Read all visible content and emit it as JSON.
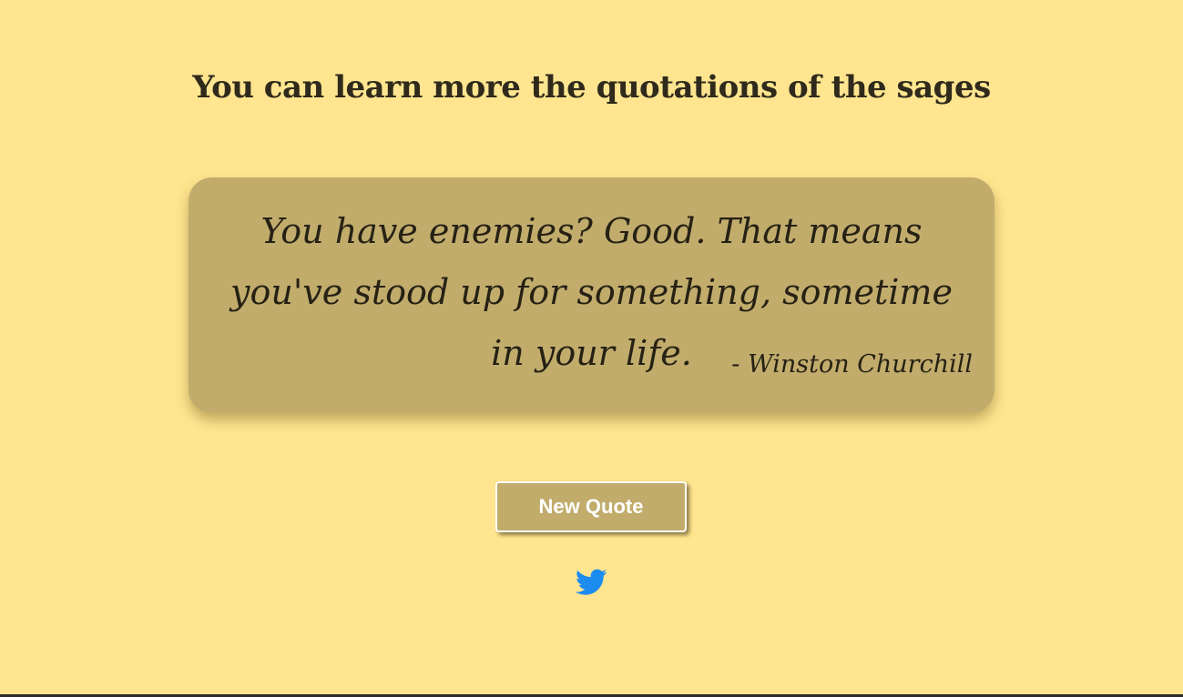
{
  "header": {
    "title": "You can learn more the quotations of the sages"
  },
  "quote": {
    "text": "You have enemies? Good. That means you've stood up for something, sometime in your life.",
    "author": "- Winston Churchill"
  },
  "actions": {
    "new_quote_label": "New Quote",
    "share_icon": "twitter-icon"
  },
  "colors": {
    "background": "#ffe58f",
    "card": "#c1ac6c",
    "text": "#262114",
    "twitter": "#1d8cf0"
  }
}
